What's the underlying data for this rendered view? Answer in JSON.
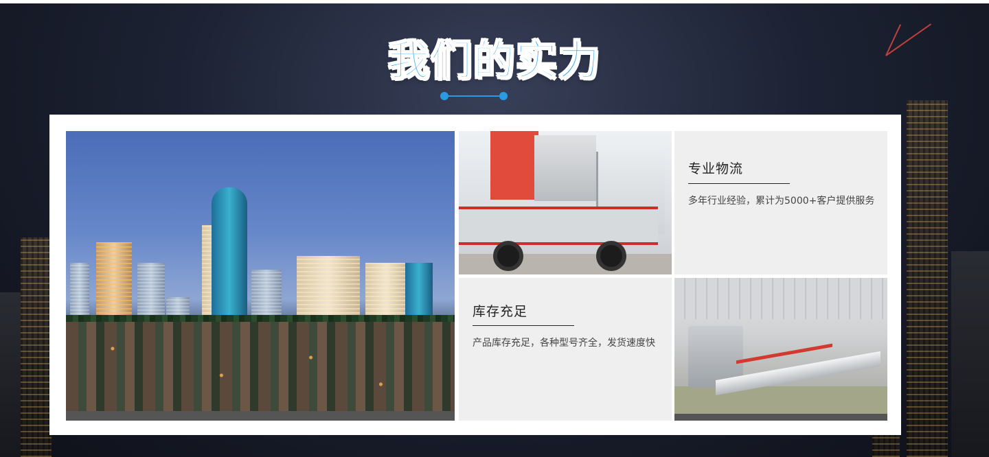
{
  "section": {
    "title": "我们的实力"
  },
  "cards": [
    {
      "heading": "专业物流",
      "description": "多年行业经验，累计为5000+客户提供服务"
    },
    {
      "heading": "库存充足",
      "description": "产品库存充足，各种型号齐全，发货速度快"
    }
  ],
  "images": {
    "city": "city-skyline-photo",
    "truck": "delivery-truck-photo",
    "factory": "factory-machine-photo"
  },
  "colors": {
    "accent": "#2a9be3",
    "title_fill": "#2aa3ef",
    "panel_bg": "#ffffff",
    "card_bg": "#efefef"
  }
}
